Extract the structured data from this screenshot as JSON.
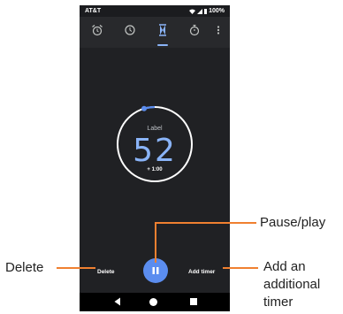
{
  "status_bar": {
    "carrier": "AT&T",
    "battery": "100%"
  },
  "tabs": [
    {
      "name": "alarm",
      "icon": "alarm-clock-icon"
    },
    {
      "name": "clock",
      "icon": "clock-icon"
    },
    {
      "name": "timer",
      "icon": "hourglass-icon",
      "selected": true
    },
    {
      "name": "stopwatch",
      "icon": "stopwatch-icon"
    }
  ],
  "timer": {
    "label": "Label",
    "value": "52",
    "add_minute_label": "+ 1:00"
  },
  "controls": {
    "delete_label": "Delete",
    "add_timer_label": "Add timer"
  },
  "callouts": {
    "delete": "Delete",
    "pause_play": "Pause/play",
    "add_timer": "Add an additional timer"
  },
  "colors": {
    "accent": "#8ab4f8",
    "fab": "#5b8def",
    "callout_line": "#f08030",
    "background": "#202124"
  }
}
